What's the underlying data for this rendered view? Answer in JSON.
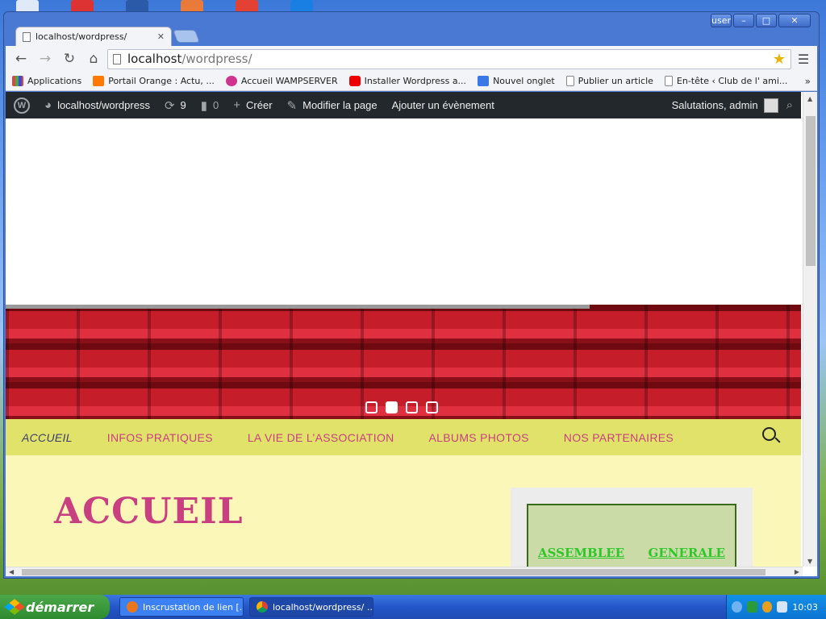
{
  "browser": {
    "tab": {
      "title": "localhost/wordpress/"
    },
    "url": {
      "host": "localhost",
      "path": "/wordpress/"
    },
    "window_controls": [
      "user",
      "–",
      "□",
      "✕"
    ]
  },
  "bookmarks": [
    {
      "label": "Applications",
      "icon": "apps-grid-icon"
    },
    {
      "label": "Portail Orange : Actu, ...",
      "icon": "orange-icon"
    },
    {
      "label": "Accueil WAMPSERVER",
      "icon": "wamp-icon"
    },
    {
      "label": "Installer Wordpress a...",
      "icon": "youtube-icon"
    },
    {
      "label": "Nouvel onglet",
      "icon": "google-icon"
    },
    {
      "label": "Publier un article",
      "icon": "page-icon"
    },
    {
      "label": "En-tête ‹ Club de l' ami...",
      "icon": "page-icon"
    }
  ],
  "adminbar": {
    "site": "localhost/wordpress",
    "updates": "9",
    "comments": "0",
    "create": "Créer",
    "edit": "Modifier la page",
    "event": "Ajouter un évènement",
    "greeting": "Salutations, admin"
  },
  "slider": {
    "slides": 4,
    "active": 2
  },
  "nav": {
    "items": [
      {
        "label": "ACCUEIL",
        "current": true
      },
      {
        "label": "INFOS PRATIQUES",
        "current": false
      },
      {
        "label": "LA VIE DE L’ASSOCIATION",
        "current": false
      },
      {
        "label": "ALBUMS PHOTOS",
        "current": false
      },
      {
        "label": "NOS PARTENAIRES",
        "current": false
      }
    ]
  },
  "page": {
    "title": "ACCUEIL",
    "widget_title_left": "ASSEMBLEE",
    "widget_title_right": "GENERALE"
  },
  "taskbar": {
    "start": "démarrer",
    "tasks": [
      {
        "label": "Inscrustation de lien [...",
        "icon": "firefox-icon"
      },
      {
        "label": "localhost/wordpress/ ...",
        "icon": "chrome-icon"
      }
    ],
    "clock": "10:03"
  },
  "colors": {
    "accent_pink": "#c8407f",
    "nav_bg": "#e1e26a",
    "content_bg": "#fbf7b8",
    "widget_title": "#2ec72a"
  }
}
